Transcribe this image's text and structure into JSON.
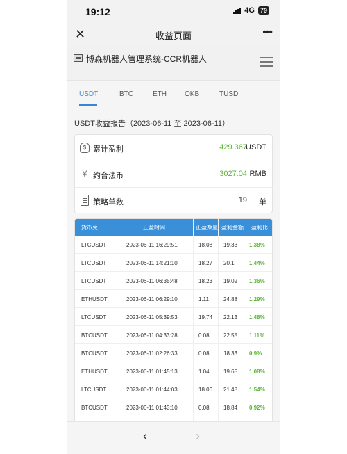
{
  "status_bar": {
    "time": "19:12",
    "network": "4G",
    "battery": "79"
  },
  "navbar": {
    "close_icon": "close-icon",
    "title": "收益页面",
    "more": "•••"
  },
  "app_header": {
    "name": "博森机器人管理系统-CCR机器人"
  },
  "tabs": [
    {
      "label": "USDT",
      "active": true
    },
    {
      "label": "BTC"
    },
    {
      "label": "ETH"
    },
    {
      "label": "OKB"
    },
    {
      "label": "TUSD"
    }
  ],
  "report_title": "USDT收益报告（2023-06-11 至 2023-06-11）",
  "summary": [
    {
      "icon": "money-bag-icon",
      "icon_glyph": "$",
      "label": "累计盈利",
      "value": "429.367",
      "unit": "USDT",
      "value_color": "#59b634"
    },
    {
      "icon": "yen-icon",
      "icon_glyph": "¥",
      "label": "约合法币",
      "value": "3027.04",
      "unit": "RMB",
      "value_color": "#59b634"
    },
    {
      "icon": "document-icon",
      "icon_glyph": "",
      "label": "策略单数",
      "value": "19",
      "unit": "单",
      "value_color": "#333333"
    }
  ],
  "table": {
    "headers": [
      "货币兑",
      "止盈时间",
      "止盈数量",
      "盈利金额",
      "盈利比"
    ],
    "rows": [
      [
        "LTCUSDT",
        "2023-06-11 16:29:51",
        "18.08",
        "19.33",
        "1.38%"
      ],
      [
        "LTCUSDT",
        "2023-06-11 14:21:10",
        "18.27",
        "20.1",
        "1.44%"
      ],
      [
        "LTCUSDT",
        "2023-06-11 06:35:48",
        "18.23",
        "19.02",
        "1.36%"
      ],
      [
        "ETHUSDT",
        "2023-06-11 06:29:10",
        "1.11",
        "24.88",
        "1.29%"
      ],
      [
        "LTCUSDT",
        "2023-06-11 05:39:53",
        "19.74",
        "22.13",
        "1.48%"
      ],
      [
        "BTCUSDT",
        "2023-06-11 04:33:28",
        "0.08",
        "22.55",
        "1.11%"
      ],
      [
        "BTCUSDT",
        "2023-06-11 02:26:33",
        "0.08",
        "18.33",
        "0.9%"
      ],
      [
        "ETHUSDT",
        "2023-06-11 01:45:13",
        "1.04",
        "19.65",
        "1.08%"
      ],
      [
        "LTCUSDT",
        "2023-06-11 01:44:03",
        "18.06",
        "21.48",
        "1.54%"
      ],
      [
        "BTCUSDT",
        "2023-06-11 01:43:10",
        "0.08",
        "18.84",
        "0.92%"
      ]
    ]
  },
  "bottom_nav": {
    "back": "‹",
    "forward": "›"
  }
}
